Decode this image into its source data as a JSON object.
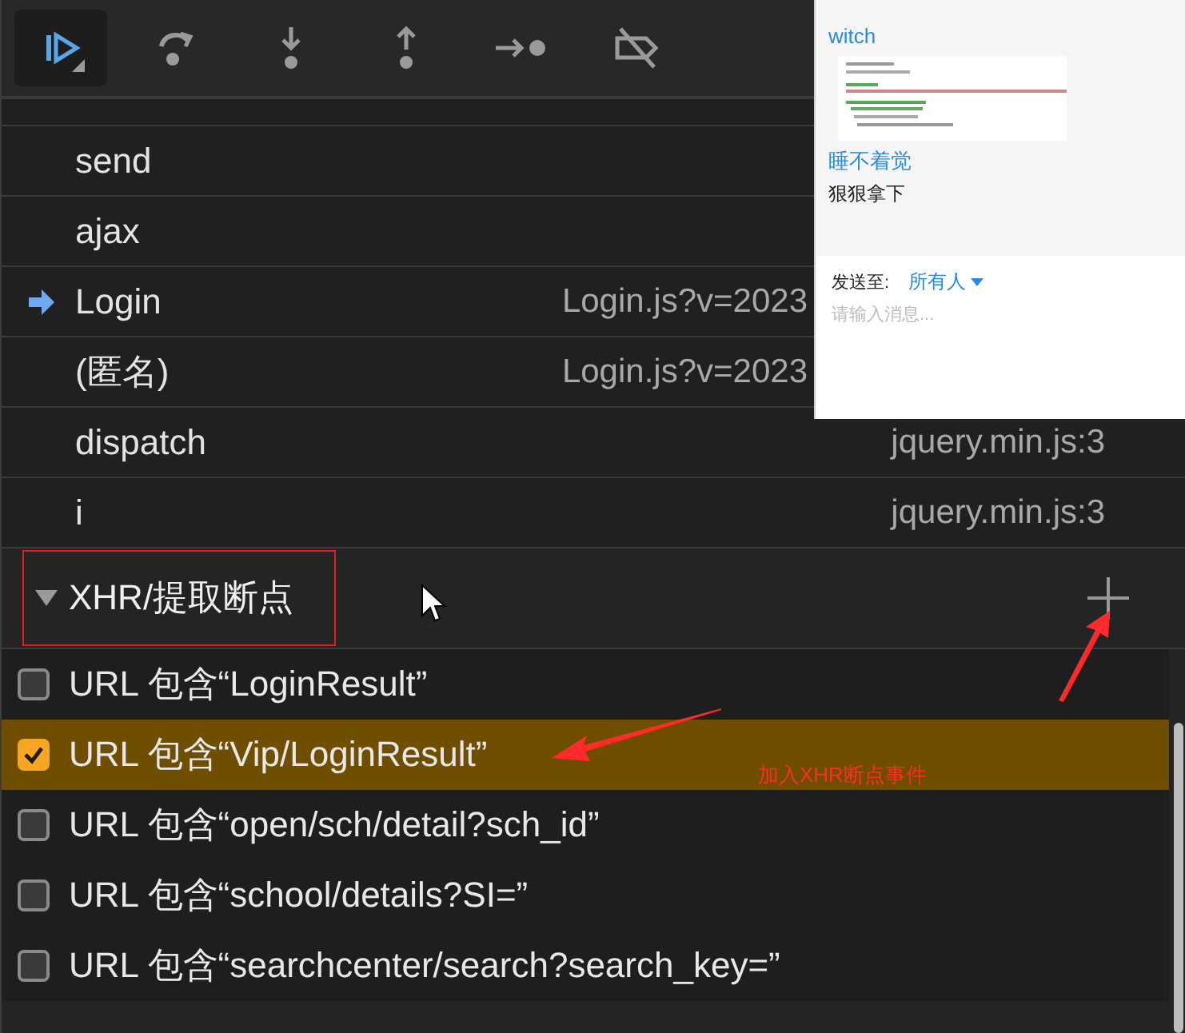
{
  "toolbar": {
    "buttons": [
      {
        "kind": "resume"
      },
      {
        "kind": "step-over"
      },
      {
        "kind": "step-into"
      },
      {
        "kind": "step-out"
      },
      {
        "kind": "step"
      },
      {
        "kind": "deactivate"
      }
    ]
  },
  "call_stack": [
    {
      "name": "send",
      "current": false
    },
    {
      "name": "ajax",
      "current": false
    },
    {
      "name": "Login",
      "location": "Login.js?v=2023",
      "covered": true,
      "current": true
    },
    {
      "name": "(匿名)",
      "location": "Login.js?v=2023",
      "covered": true,
      "current": false
    },
    {
      "name": "dispatch",
      "location": "jquery.min.js:3",
      "covered": false,
      "current": false
    },
    {
      "name": "i",
      "location": "jquery.min.js:3",
      "covered": false,
      "current": false
    }
  ],
  "xhr_breakpoints": {
    "title": "XHR/提取断点",
    "expanded": true,
    "items": [
      {
        "label": "URL 包含“LoginResult”",
        "checked": false,
        "selected": false
      },
      {
        "label": "URL 包含“Vip/LoginResult”",
        "checked": true,
        "selected": true
      },
      {
        "label": "URL 包含“open/sch/detail?sch_id”",
        "checked": false,
        "selected": false
      },
      {
        "label": "URL 包含“school/details?SI=”",
        "checked": false,
        "selected": false
      },
      {
        "label": "URL 包含“searchcenter/search?search_key=”",
        "checked": false,
        "selected": false
      }
    ]
  },
  "annotation": {
    "note": "加入XHR断点事件"
  },
  "chat": {
    "messages": [
      {
        "kind": "sender",
        "text": "witch"
      },
      {
        "kind": "picture"
      },
      {
        "kind": "sender",
        "text": "睡不着觉"
      },
      {
        "kind": "text",
        "text": "狠狠拿下"
      }
    ],
    "send_to_label": "发送至:",
    "recipient": "所有人",
    "input": {
      "placeholder": "请输入消息..."
    }
  }
}
